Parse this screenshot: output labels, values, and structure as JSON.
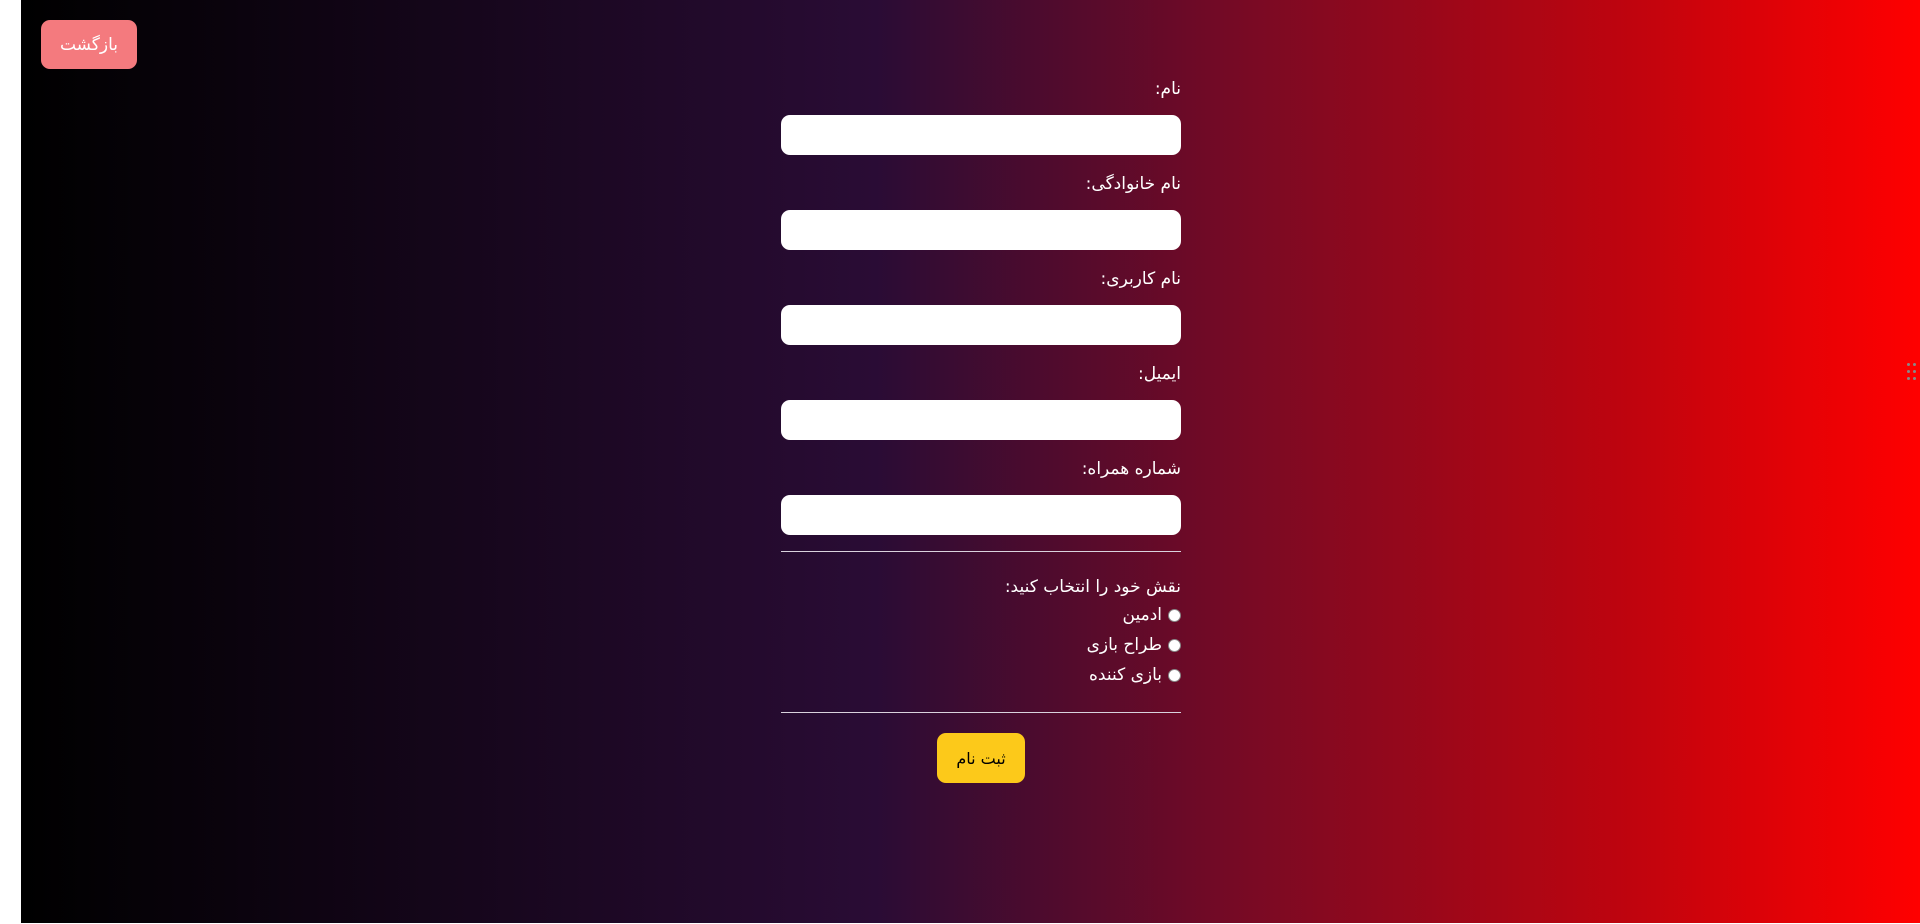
{
  "header": {
    "back_label": "بازگشت"
  },
  "form": {
    "fields": [
      {
        "label": "نام:",
        "value": "",
        "placeholder": ""
      },
      {
        "label": "نام خانوادگی:",
        "value": "",
        "placeholder": ""
      },
      {
        "label": "نام کاربری:",
        "value": "",
        "placeholder": ""
      },
      {
        "label": "ایمیل:",
        "value": "",
        "placeholder": ""
      },
      {
        "label": "شماره همراه:",
        "value": "",
        "placeholder": ""
      }
    ],
    "role_title": "نقش خود را انتخاب کنید:",
    "roles": [
      {
        "label": "ادمین",
        "selected": false
      },
      {
        "label": "طراح بازی",
        "selected": false
      },
      {
        "label": "بازی کننده",
        "selected": false
      }
    ],
    "submit_label": "ثبت نام"
  },
  "colors": {
    "background_gradient": [
      "#000000",
      "#2a0c35",
      "#ff0000"
    ],
    "back_button": "#f47a7e",
    "submit_button": "#fcc91a",
    "input_background": "#ffffff"
  },
  "icons": {
    "side_widget": "sparkle-icon",
    "drag_handle": "drag-handle-icon"
  }
}
